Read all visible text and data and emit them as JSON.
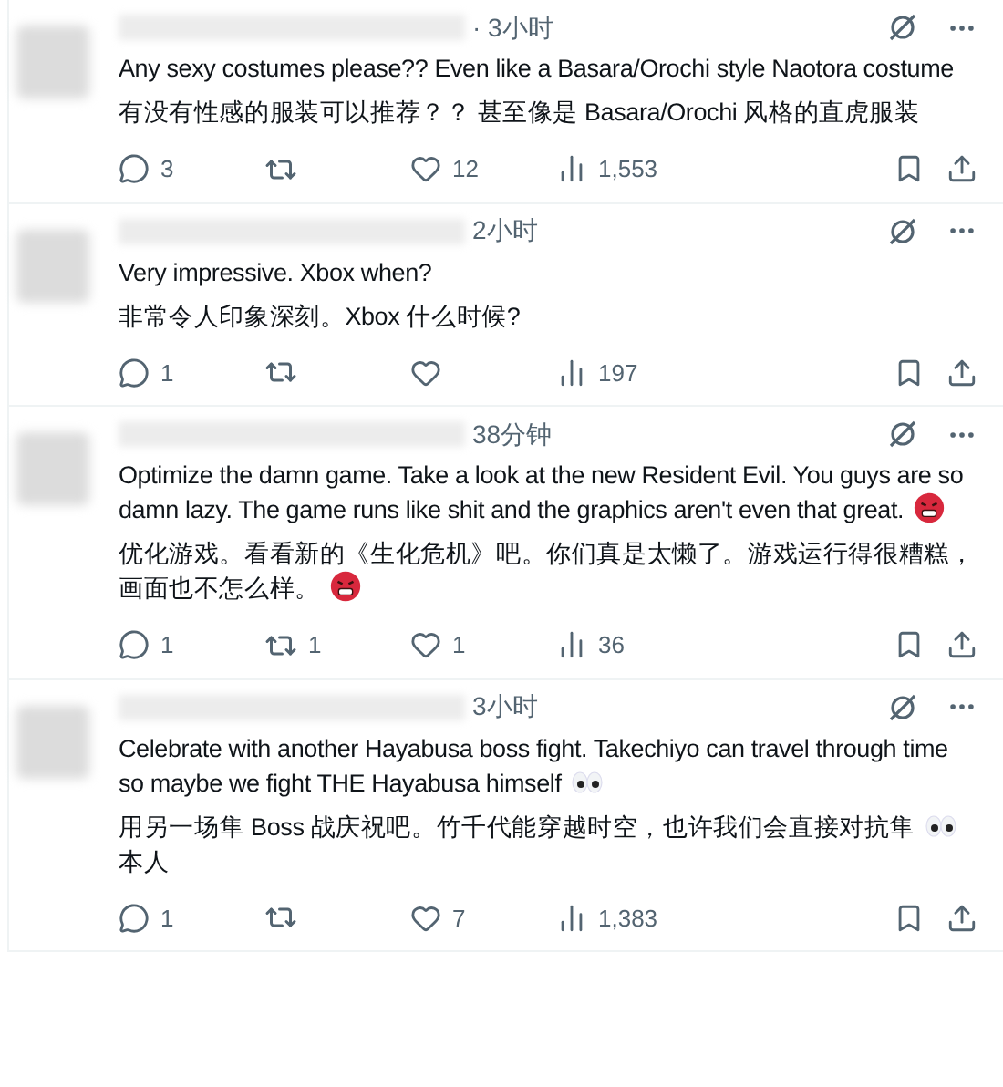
{
  "replies": [
    {
      "time": "· 3小时",
      "paragraphs": [
        [
          {
            "text": "Any sexy costumes please?? Even like a Basara/Orochi style Naotora costume"
          }
        ],
        [
          {
            "text": "有没有性感的服装可以推荐？？ 甚至像是 Basara/Orochi 风格的直虎服装"
          }
        ]
      ],
      "stats": {
        "replies": "3",
        "likes": "12",
        "views": "1,553"
      }
    },
    {
      "time": "2小时",
      "paragraphs": [
        [
          {
            "text": "Very impressive. Xbox when?"
          }
        ],
        [
          {
            "text": "非常令人印象深刻。Xbox 什么时候?"
          }
        ]
      ],
      "stats": {
        "replies": "1",
        "views": "197"
      }
    },
    {
      "time": "38分钟",
      "paragraphs": [
        [
          {
            "text": "Optimize the damn game. Take a look at the new Resident Evil. You guys are so damn lazy. The game runs like shit and the graphics aren't even that great. "
          },
          {
            "kind": "angry-face"
          }
        ],
        [
          {
            "text": "优化游戏。看看新的《生化危机》吧。你们真是太懒了。游戏运行得很糟糕，画面也不怎么样。 "
          },
          {
            "kind": "angry-face"
          }
        ]
      ],
      "stats": {
        "replies": "1",
        "reposts": "1",
        "likes": "1",
        "views": "36"
      }
    },
    {
      "time": "3小时",
      "paragraphs": [
        [
          {
            "text": "Celebrate with another Hayabusa boss fight. Takechiyo can travel through time so maybe we fight THE Hayabusa himself "
          },
          {
            "kind": "eyes"
          }
        ],
        [
          {
            "text": "用另一场隼 Boss 战庆祝吧。竹千代能穿越时空，也许我们会直接对抗隼 "
          },
          {
            "kind": "eyes"
          },
          {
            "text": " 本人"
          }
        ]
      ],
      "stats": {
        "replies": "1",
        "likes": "7",
        "views": "1,383"
      }
    }
  ]
}
